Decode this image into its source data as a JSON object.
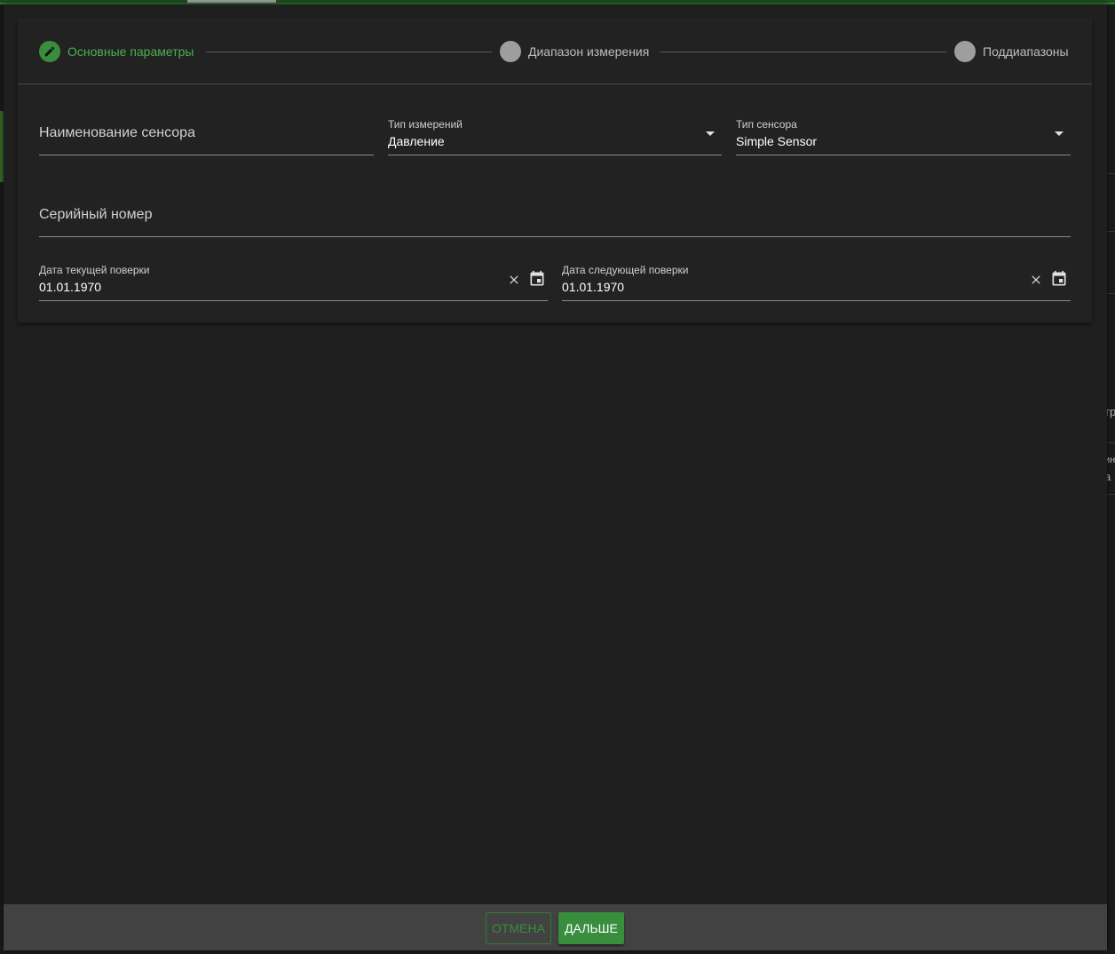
{
  "stepper": {
    "steps": [
      {
        "label": "Основные параметры",
        "state": "active",
        "icon": "pencil-icon"
      },
      {
        "label": "Диапазон измерения",
        "state": "inactive"
      },
      {
        "label": "Поддиапазоны",
        "state": "inactive"
      }
    ]
  },
  "form": {
    "sensor_name": {
      "placeholder": "Наименование сенсора",
      "value": ""
    },
    "measurement_type": {
      "label": "Тип измерений",
      "value": "Давление"
    },
    "sensor_type": {
      "label": "Тип сенсора",
      "value": "Simple Sensor"
    },
    "serial_number": {
      "placeholder": "Серийный номер",
      "value": ""
    },
    "current_check_date": {
      "label": "Дата текущей поверки",
      "value": "01.01.1970"
    },
    "next_check_date": {
      "label": "Дата следующей поверки",
      "value": "01.01.1970"
    }
  },
  "footer": {
    "cancel_label": "Отмена",
    "next_label": "Дальше"
  },
  "background": {
    "right_text_1": "тр",
    "right_text_2": "ин",
    "right_text_3": "а"
  },
  "colors": {
    "accent": "#388e3c",
    "accent_text": "#4caf50",
    "dialog_bg": "#1f1f1f",
    "footer_bg": "#424242",
    "inactive_step": "#9e9e9e"
  }
}
